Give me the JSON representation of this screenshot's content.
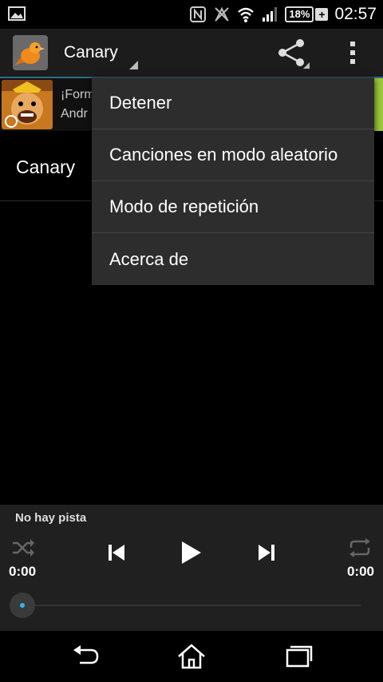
{
  "status_bar": {
    "time": "02:57",
    "battery": "18%",
    "battery_charging": "+",
    "icons": [
      "image-icon",
      "nfc-icon",
      "no-signal-icon",
      "wifi-icon",
      "cell-signal-icon",
      "battery-icon"
    ]
  },
  "action_bar": {
    "title": "Canary",
    "icons": [
      "app-canary-icon",
      "share-icon",
      "overflow-menu-icon"
    ]
  },
  "ad": {
    "line1": "¡Form",
    "line2": "Andr"
  },
  "list": {
    "item_label": "Canary"
  },
  "menu": {
    "items": [
      "Detener",
      "Canciones en modo aleatorio",
      "Modo de repetición",
      "Acerca de"
    ]
  },
  "player": {
    "track_label": "No hay pista",
    "time_elapsed": "0:00",
    "time_total": "0:00",
    "progress": 0
  },
  "colors": {
    "accent": "#33b5e5",
    "actionbar_line": "#2a6f87",
    "ad_green": "#9cc83b",
    "menu_bg": "#2d2d2d",
    "player_bg": "#202020"
  }
}
